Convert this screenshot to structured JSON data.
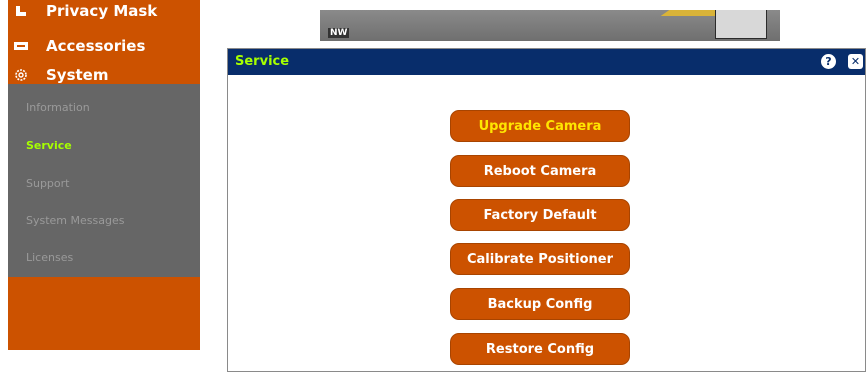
{
  "sidebar": {
    "top_items": [
      {
        "label": "Privacy Mask",
        "icon": "privacy-mask-icon"
      },
      {
        "label": "Accessories",
        "icon": "accessories-icon"
      },
      {
        "label": "System",
        "icon": "gear-icon"
      }
    ],
    "sub_items": [
      {
        "label": "Information",
        "active": false
      },
      {
        "label": "Service",
        "active": true
      },
      {
        "label": "Support",
        "active": false
      },
      {
        "label": "System Messages",
        "active": false
      },
      {
        "label": "Licenses",
        "active": false
      }
    ]
  },
  "preview": {
    "direction_label": "NW"
  },
  "dialog": {
    "title": "Service",
    "help_icon": "help-icon",
    "close_icon": "close-icon",
    "buttons": [
      {
        "label": "Upgrade Camera"
      },
      {
        "label": "Reboot Camera"
      },
      {
        "label": "Factory Default"
      },
      {
        "label": "Calibrate Positioner"
      },
      {
        "label": "Backup Config"
      },
      {
        "label": "Restore Config"
      }
    ]
  },
  "colors": {
    "accent_orange": "#cc5200",
    "header_navy": "#082d6b",
    "active_green": "#a6ff00",
    "highlight_yellow": "#ffe600",
    "submenu_gray": "#666666"
  }
}
